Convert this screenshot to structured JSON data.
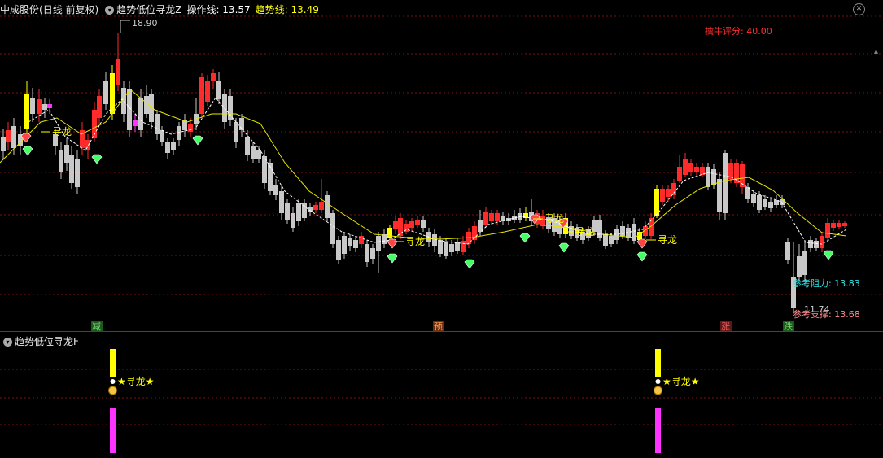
{
  "main_header": {
    "stock_name": "中成股份",
    "period": "(日线 前复权)",
    "indicator_name": "趋势低位寻龙Z",
    "op_line_label": "操作线: 13.57",
    "trend_line_label": "趋势线: 13.49"
  },
  "score_label": "擒牛评分: 40.00",
  "price_labels": {
    "high": "18.90",
    "low": "11.74",
    "resistance": "参考阻力: 13.83",
    "support": "参考支撑: 13.68"
  },
  "signal_label": "寻龙",
  "markers": [
    {
      "text": "减",
      "color": "#7bd17b"
    },
    {
      "text": "预",
      "color": "#ff9c5a"
    },
    {
      "text": "涨",
      "color": "#ff5c5c"
    },
    {
      "text": "跌",
      "color": "#7bd17b"
    }
  ],
  "sub_header": {
    "indicator_name": "趋势低位寻龙F",
    "signal_text": "★寻龙★"
  },
  "window_controls": {
    "close_icon": "close-icon",
    "expand_icon": "expand-icon"
  },
  "colors": {
    "up": "#ff2a2a",
    "down": "#c8c8c8",
    "highlight": "#ffff00",
    "magenta": "#ff33ff",
    "trend_line": "#e6e600",
    "grid": "#7a1010"
  }
}
